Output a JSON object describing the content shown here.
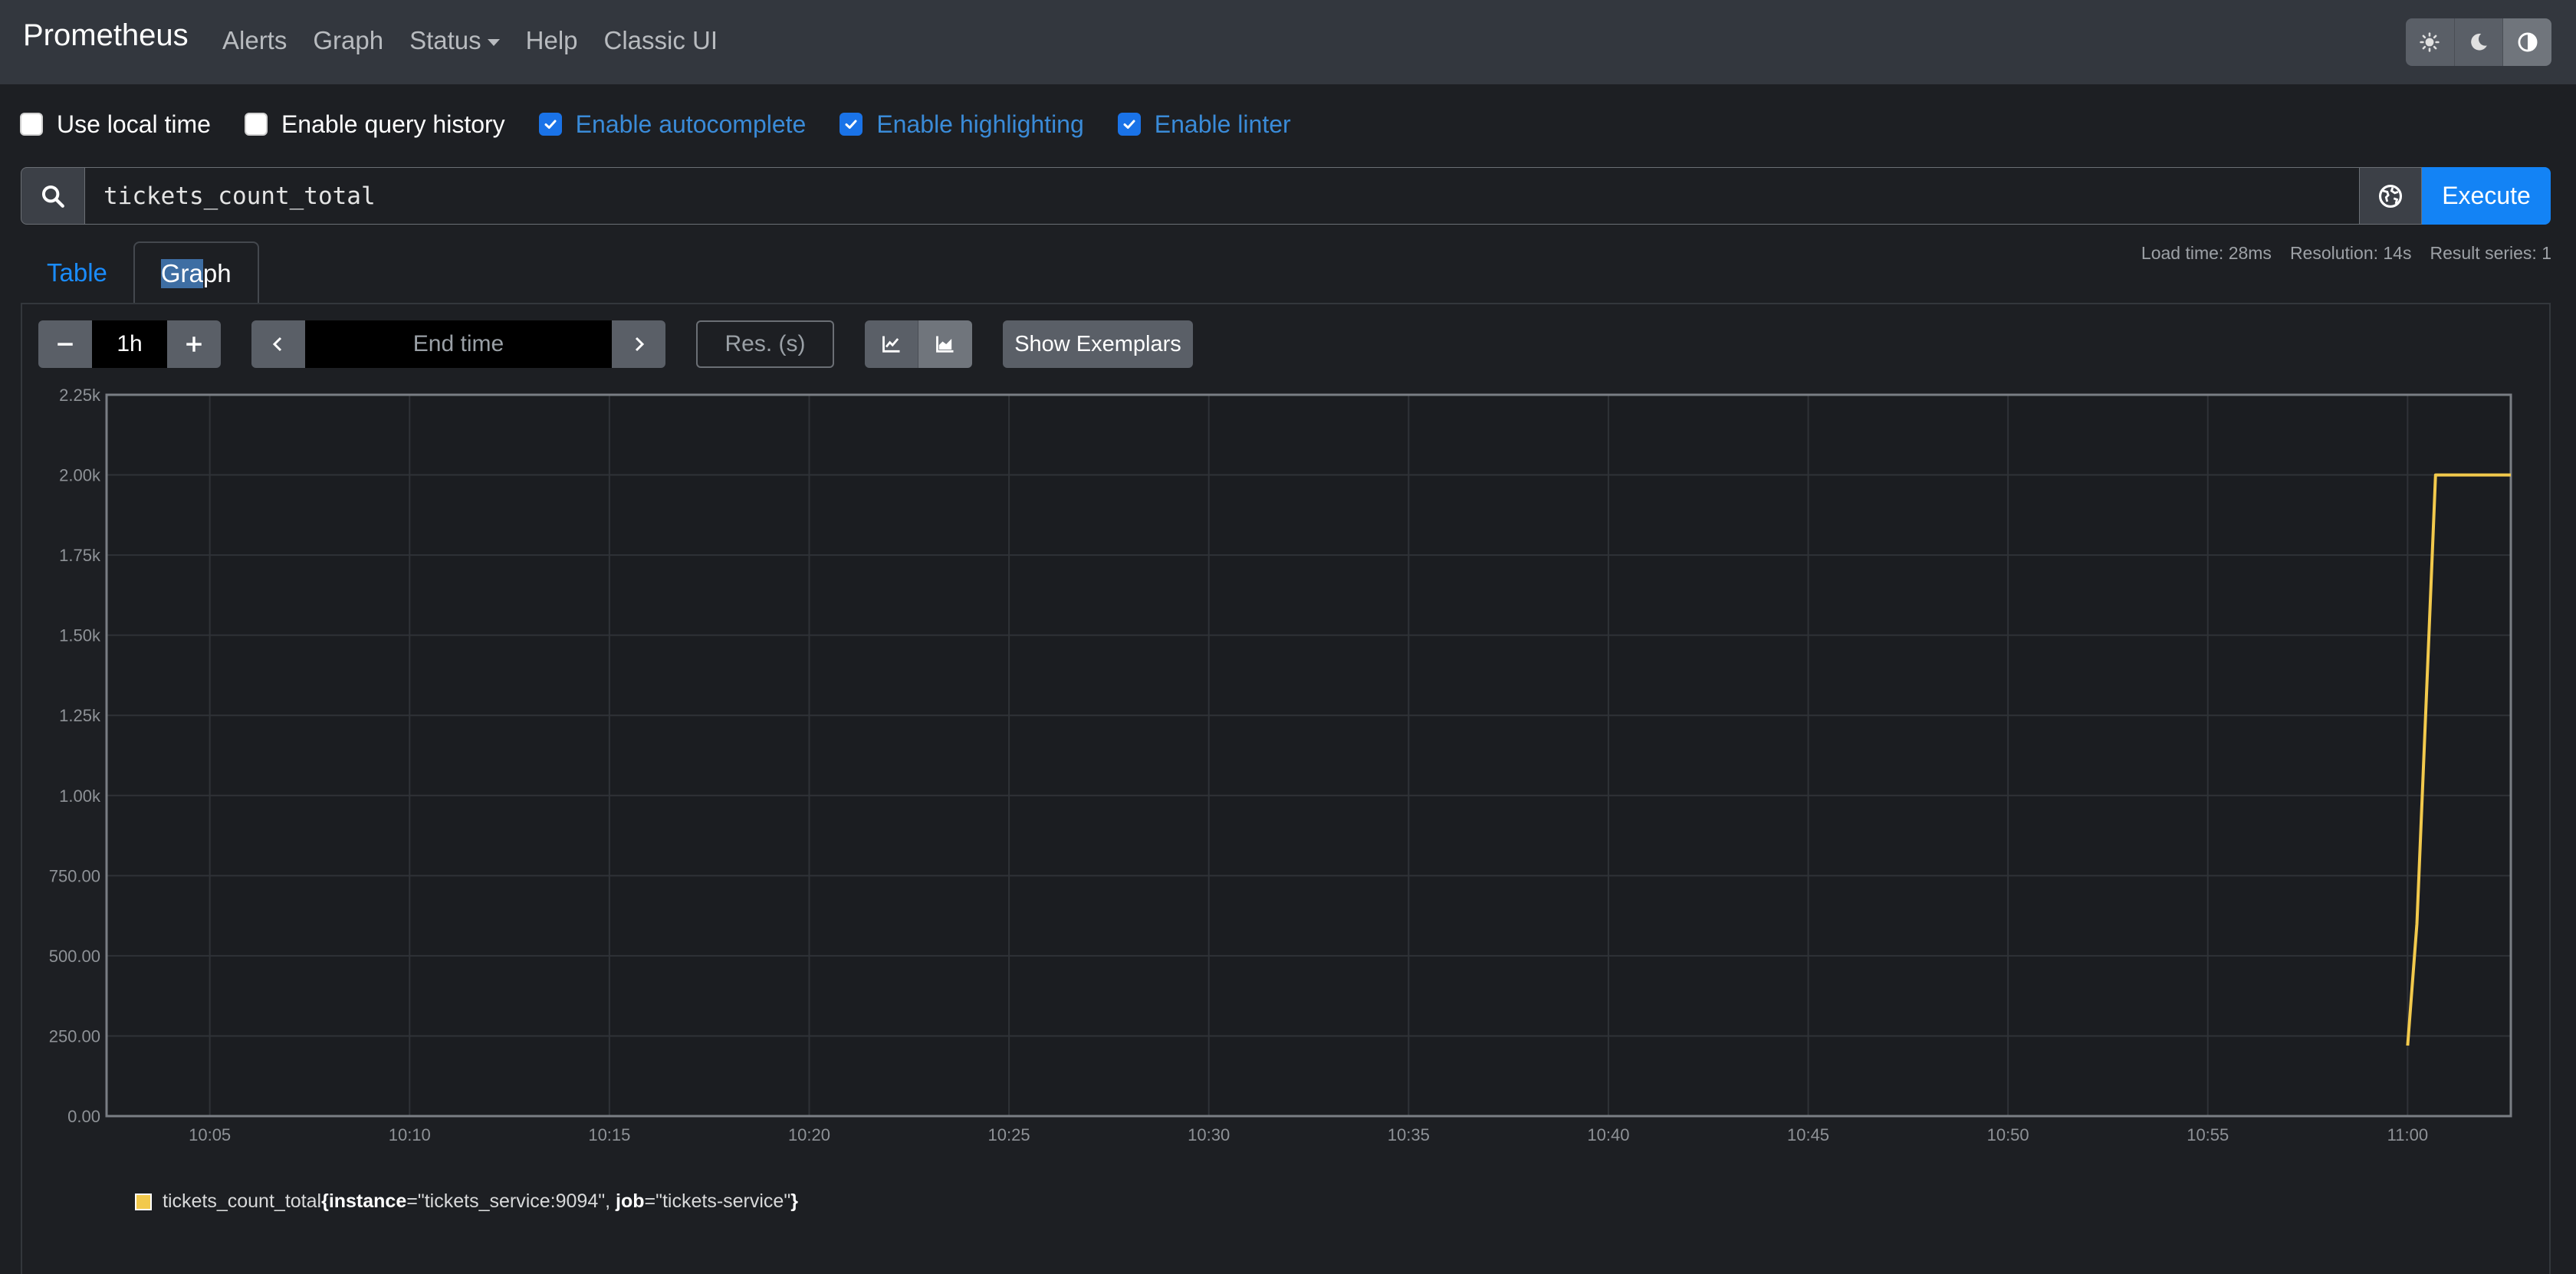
{
  "navbar": {
    "brand": "Prometheus",
    "links": [
      "Alerts",
      "Graph",
      "Status",
      "Help",
      "Classic UI"
    ],
    "theme_buttons": [
      "sun-icon",
      "moon-icon",
      "contrast-icon"
    ]
  },
  "options": [
    {
      "label": "Use local time",
      "checked": false
    },
    {
      "label": "Enable query history",
      "checked": false
    },
    {
      "label": "Enable autocomplete",
      "checked": true
    },
    {
      "label": "Enable highlighting",
      "checked": true
    },
    {
      "label": "Enable linter",
      "checked": true
    }
  ],
  "query": {
    "expression": "tickets_count_total",
    "execute_label": "Execute"
  },
  "tabs": {
    "table": "Table",
    "graph_selected": "Gra",
    "graph_rest": "ph"
  },
  "stats": {
    "load_time": "Load time: 28ms",
    "resolution": "Resolution: 14s",
    "result_series": "Result series: 1"
  },
  "controls": {
    "range": "1h",
    "end_time_placeholder": "End time",
    "resolution_placeholder": "Res. (s)",
    "exemplars_label": "Show Exemplars"
  },
  "colors": {
    "series": "#f2c94c",
    "accent": "#1383f5"
  },
  "legend": {
    "metric": "tickets_count_total",
    "open": "{",
    "instance_key": "instance",
    "instance_value": "=\"tickets_service:9094\", ",
    "job_key": "job",
    "job_value": "=\"tickets-service\"",
    "close": "}"
  },
  "chart_data": {
    "type": "line",
    "y_ticks": [
      "0.00",
      "250.00",
      "500.00",
      "750.00",
      "1.00k",
      "1.25k",
      "1.50k",
      "1.75k",
      "2.00k",
      "2.25k"
    ],
    "x_ticks": [
      "10:05",
      "10:10",
      "10:15",
      "10:20",
      "10:25",
      "10:30",
      "10:35",
      "10:40",
      "10:45",
      "10:50",
      "10:55",
      "11:00"
    ],
    "xlim": [
      "10:02:25",
      "11:02:35"
    ],
    "ylim": [
      0,
      2250
    ],
    "grid": true,
    "series": [
      {
        "name": "tickets_count_total{instance=\"tickets_service:9094\", job=\"tickets-service\"}",
        "x": [
          "11:00:00",
          "11:00:14",
          "11:00:28",
          "11:00:42",
          "11:01:00",
          "11:02:00",
          "11:02:35"
        ],
        "y": [
          220,
          600,
          1300,
          2000,
          2000,
          2000,
          2000
        ]
      }
    ]
  }
}
